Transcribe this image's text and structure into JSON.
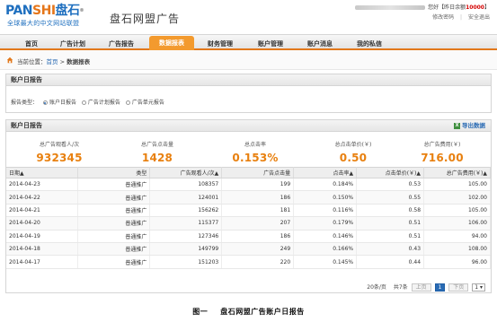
{
  "header": {
    "logo_part1": "PAN",
    "logo_part2": "SHI",
    "logo_cn": "盘石",
    "logo_reg": "®",
    "logo_tagline": "全球最大的中文网站联盟",
    "brand": "盘石网盟广告",
    "greeting": "您好",
    "balance_label": "【昨日余额",
    "balance_value": "10000",
    "balance_end": "】",
    "link_change_password": "修改密码",
    "link_separator": "|",
    "link_logout": "安全退出"
  },
  "nav": {
    "items": [
      "首页",
      "广告计划",
      "广告报告",
      "数据报表",
      "财务管理",
      "账户管理",
      "账户消息",
      "我的私信"
    ],
    "active_index": 3
  },
  "breadcrumb": {
    "prefix": "当前位置：",
    "home": "首页",
    "sep": " > ",
    "current": "数据报表"
  },
  "filter_panel": {
    "title": "账户日报告",
    "type_label": "报告类型：",
    "options": [
      {
        "label": "账户日报告",
        "selected": true
      },
      {
        "label": "广告计划报告",
        "selected": false
      },
      {
        "label": "广告单元报告",
        "selected": false
      }
    ]
  },
  "report_panel": {
    "title": "账户日报告",
    "export_label": "导出数据",
    "export_icon": "excel-icon",
    "stats": [
      {
        "label": "总广告观看人/次",
        "value": "932345"
      },
      {
        "label": "总广告点击量",
        "value": "1428"
      },
      {
        "label": "总点击率",
        "value": "0.153%"
      },
      {
        "label": "总点击单价(￥)",
        "value": "0.50"
      },
      {
        "label": "总广告费用(￥)",
        "value": "716.00"
      }
    ],
    "table": {
      "headers": [
        "日期▲",
        "类型",
        "广告观看人/次▲",
        "广告点击量",
        "点击率▲",
        "点击单价(￥)▲",
        "总广告费用(￥)▲"
      ],
      "rows": [
        [
          "2014-04-23",
          "普通推广",
          "108357",
          "199",
          "0.184%",
          "0.53",
          "105.00"
        ],
        [
          "2014-04-22",
          "普通推广",
          "124001",
          "186",
          "0.150%",
          "0.55",
          "102.00"
        ],
        [
          "2014-04-21",
          "普通推广",
          "156262",
          "181",
          "0.116%",
          "0.58",
          "105.00"
        ],
        [
          "2014-04-20",
          "普通推广",
          "115377",
          "207",
          "0.179%",
          "0.51",
          "106.00"
        ],
        [
          "2014-04-19",
          "普通推广",
          "127346",
          "186",
          "0.146%",
          "0.51",
          "94.00"
        ],
        [
          "2014-04-18",
          "普通推广",
          "149799",
          "249",
          "0.166%",
          "0.43",
          "108.00"
        ],
        [
          "2014-04-17",
          "普通推广",
          "151203",
          "220",
          "0.145%",
          "0.44",
          "96.00"
        ]
      ]
    },
    "pager": {
      "per_page": "20条/页",
      "total": "共7条",
      "prev": "上页",
      "page": "1",
      "next": "下页",
      "select_value": "1"
    }
  },
  "caption": {
    "figure": "图一",
    "text": "盘石网盟广告账户日报告"
  },
  "colors": {
    "accent_orange": "#e8800f",
    "nav_active": "#f39a2e",
    "link_blue": "#2a6bb4",
    "balance_red": "#d40000"
  }
}
